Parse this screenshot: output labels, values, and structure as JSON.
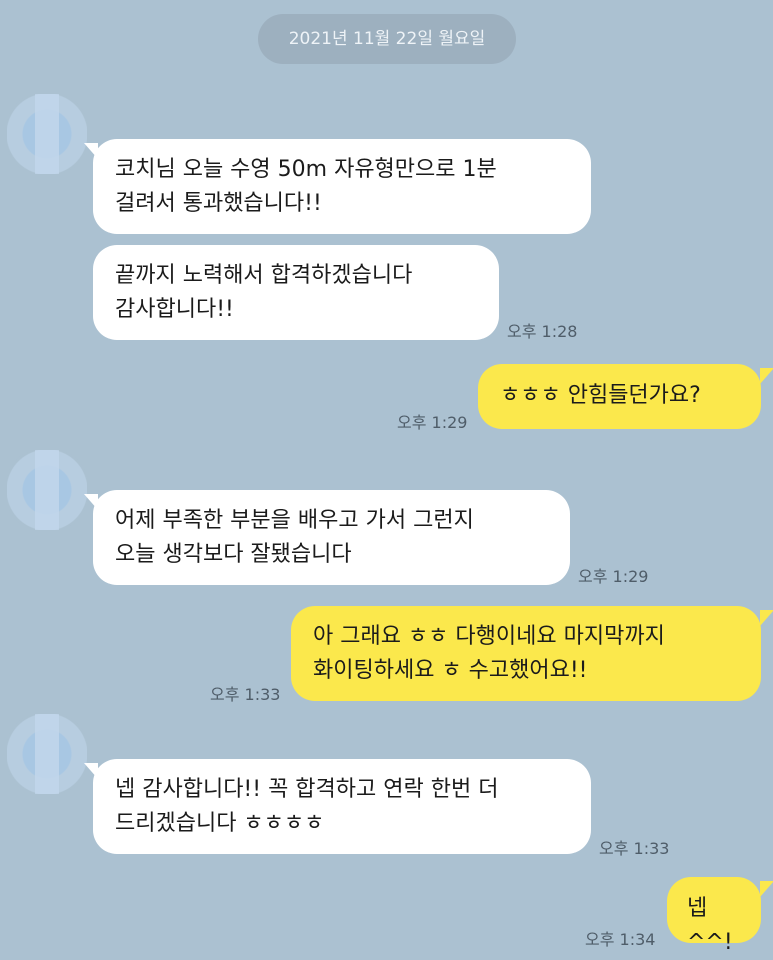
{
  "date_divider": "2021년 11월 22일 월요일",
  "messages": [
    {
      "side": "in",
      "text": "코치님 오늘 수영 50m 자유형만으로 1분\n걸려서 통과했습니다!!",
      "time": ""
    },
    {
      "side": "in",
      "text": "끝까지 노력해서 합격하겠습니다\n감사합니다!!",
      "time": "오후 1:28"
    },
    {
      "side": "out",
      "text": "ㅎㅎㅎ 안힘들던가요?",
      "time": "오후 1:29"
    },
    {
      "side": "in",
      "text": "어제 부족한 부분을 배우고 가서 그런지\n오늘 생각보다 잘됐습니다",
      "time": "오후 1:29"
    },
    {
      "side": "out",
      "text": "아 그래요 ㅎㅎ 다행이네요 마지막까지\n화이팅하세요 ㅎ 수고했어요!!",
      "time": "오후 1:33"
    },
    {
      "side": "in",
      "text": "넵 감사합니다!! 꼭 합격하고 연락 한번 더\n드리겠습니다 ㅎㅎㅎㅎ",
      "time": "오후 1:33"
    },
    {
      "side": "out",
      "text": "넵^^!",
      "time": "오후 1:34"
    }
  ],
  "colors": {
    "background": "#abc1d1",
    "incoming": "#ffffff",
    "outgoing": "#fbe84c"
  }
}
